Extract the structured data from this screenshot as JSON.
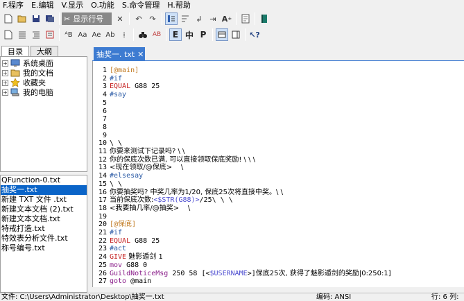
{
  "menu": [
    "F.程序",
    "E.编辑",
    "V.显示",
    "O.功能",
    "S.命令管理",
    "H.帮助"
  ],
  "toolbar1": {
    "cut_field": "显示行号"
  },
  "toolbar2": {
    "btn_e": "E",
    "btn_zhong": "中",
    "btn_p": "P"
  },
  "left_tabs": [
    "目录",
    "大纲"
  ],
  "tree": [
    "系统桌面",
    "我的文档",
    "收藏夹",
    "我的电脑"
  ],
  "files": [
    "QFunction-0.txt",
    "抽奖一.txt",
    "新建 TXT 文件 .txt",
    "新建文本文档 (2).txt",
    "新建文本文档.txt",
    "特戒打造.txt",
    "特效表分析文件.txt",
    "称号编号.txt"
  ],
  "editor_tab": "抽奖一. txt",
  "code": [
    {
      "n": "1",
      "parts": [
        {
          "c": "c-label",
          "t": "[@main]"
        }
      ]
    },
    {
      "n": "2",
      "parts": [
        {
          "c": "c-dir",
          "t": "#if"
        }
      ]
    },
    {
      "n": "3",
      "parts": [
        {
          "c": "c-kw",
          "t": "EQUAL"
        },
        {
          "c": "",
          "t": " G88 25"
        }
      ]
    },
    {
      "n": "4",
      "parts": [
        {
          "c": "c-dir",
          "t": "#say"
        }
      ]
    },
    {
      "n": "5",
      "parts": []
    },
    {
      "n": "6",
      "parts": [],
      "hl": true
    },
    {
      "n": "7",
      "parts": []
    },
    {
      "n": "8",
      "parts": []
    },
    {
      "n": "9",
      "parts": []
    },
    {
      "n": "10",
      "parts": [
        {
          "c": "",
          "t": "\\ \\"
        }
      ]
    },
    {
      "n": "11",
      "parts": [
        {
          "c": "c-cn",
          "t": "你要来测试下记录吗? \\ \\"
        }
      ]
    },
    {
      "n": "12",
      "parts": [
        {
          "c": "c-cn",
          "t": "你的保底次数已满, 可以直接领取保底奖励! \\ \\ \\"
        }
      ]
    },
    {
      "n": "13",
      "parts": [
        {
          "c": "c-cn",
          "t": "<现在领取/@保底>    \\"
        }
      ]
    },
    {
      "n": "14",
      "parts": [
        {
          "c": "c-dir",
          "t": "#elsesay"
        }
      ]
    },
    {
      "n": "15",
      "parts": [
        {
          "c": "",
          "t": "\\ \\"
        }
      ]
    },
    {
      "n": "16",
      "parts": [
        {
          "c": "c-cn",
          "t": "你要抽奖吗? 中奖几率为1/20, 保底25次将直接中奖。\\ \\"
        }
      ]
    },
    {
      "n": "17",
      "parts": [
        {
          "c": "c-cn",
          "t": "当前保底次数:"
        },
        {
          "c": "c-var",
          "t": "<$STR(G88)>"
        },
        {
          "c": "",
          "t": "/25\\ \\ \\"
        }
      ]
    },
    {
      "n": "18",
      "parts": [
        {
          "c": "c-cn",
          "t": "<我要抽几率/@抽奖>    \\"
        }
      ]
    },
    {
      "n": "19",
      "parts": []
    },
    {
      "n": "20",
      "parts": [
        {
          "c": "c-label",
          "t": "[@保底]"
        }
      ]
    },
    {
      "n": "21",
      "parts": [
        {
          "c": "c-dir",
          "t": "#if"
        }
      ]
    },
    {
      "n": "22",
      "parts": [
        {
          "c": "c-kw",
          "t": "EQUAL"
        },
        {
          "c": "",
          "t": " G88 25"
        }
      ]
    },
    {
      "n": "23",
      "parts": [
        {
          "c": "c-dir",
          "t": "#act"
        }
      ]
    },
    {
      "n": "24",
      "parts": [
        {
          "c": "c-kw",
          "t": "GIVE"
        },
        {
          "c": "c-cn",
          "t": " 魅影遁剑 1"
        }
      ]
    },
    {
      "n": "25",
      "parts": [
        {
          "c": "c-fn",
          "t": "mov"
        },
        {
          "c": "",
          "t": " G88 0"
        }
      ]
    },
    {
      "n": "26",
      "parts": [
        {
          "c": "c-fn",
          "t": "GuildNoticeMsg"
        },
        {
          "c": "",
          "t": " 250 58 [<"
        },
        {
          "c": "c-var",
          "t": "$USERNAME"
        },
        {
          "c": "",
          "t": ">]"
        },
        {
          "c": "c-cn",
          "t": "保底25次, 获得了魅影遁剑的奖励|0:250:1]"
        }
      ]
    },
    {
      "n": "27",
      "parts": [
        {
          "c": "c-fn",
          "t": "goto"
        },
        {
          "c": "",
          "t": " @main"
        }
      ]
    }
  ],
  "status": {
    "path": "文件: C:\\Users\\Administrator\\Desktop\\抽奖一.txt",
    "encoding": "编码: ANSI",
    "pos": "行: 6  列:"
  }
}
